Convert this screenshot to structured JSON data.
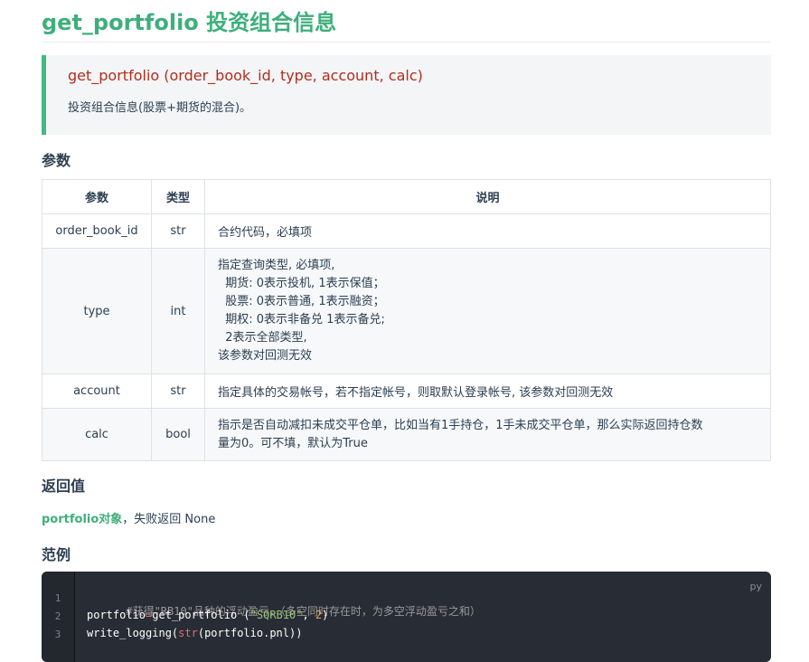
{
  "title": "get_portfolio 投资组合信息",
  "signature": "get_portfolio (order_book_id, type, account, calc)",
  "signature_desc": "投资组合信息(股票+期货的混合)。",
  "params_heading": "参数",
  "table": {
    "headers": [
      "参数",
      "类型",
      "说明"
    ],
    "rows": [
      {
        "param": "order_book_id",
        "type": "str",
        "desc": [
          "合约代码，必填项"
        ]
      },
      {
        "param": "type",
        "type": "int",
        "desc": [
          "指定查询类型, 必填项,",
          "  期货: 0表示投机, 1表示保值；",
          "  股票: 0表示普通, 1表示融资；",
          "  期权: 0表示非备兑 1表示备兑;",
          "  2表示全部类型,",
          "该参数对回测无效"
        ]
      },
      {
        "param": "account",
        "type": "str",
        "desc": [
          "指定具体的交易帐号，若不指定帐号，则取默认登录帐号, 该参数对回测无效"
        ]
      },
      {
        "param": "calc",
        "type": "bool",
        "desc": [
          "指示是否自动减扣未成交平仓单，比如当有1手持仓，1手未成交平仓单，那么实际返回持仓数",
          "量为0。可不填，默认为True"
        ]
      }
    ]
  },
  "return_heading": "返回值",
  "return_link": "portfolio对象",
  "return_rest": "，失败返回 None",
  "example_heading": "范例",
  "code": {
    "lang": "py",
    "line_numbers": [
      "1",
      "2",
      "3"
    ],
    "line1_comment": "#获得\"RB10\"品种的浮动盈亏，（多空同时存在时，为多空浮动盈亏之和）",
    "line2_pre": "portfolio",
    "line2_eq": "=",
    "line2_call": "get_portfolio (",
    "line2_str": "\"SQRB10\"",
    "line2_comma": ", ",
    "line2_num": "2",
    "line2_close": ")",
    "line3_fn": "write_logging",
    "line3_open": "(",
    "line3_builtin": "str",
    "line3_rest": "(portfolio.pnl))"
  }
}
